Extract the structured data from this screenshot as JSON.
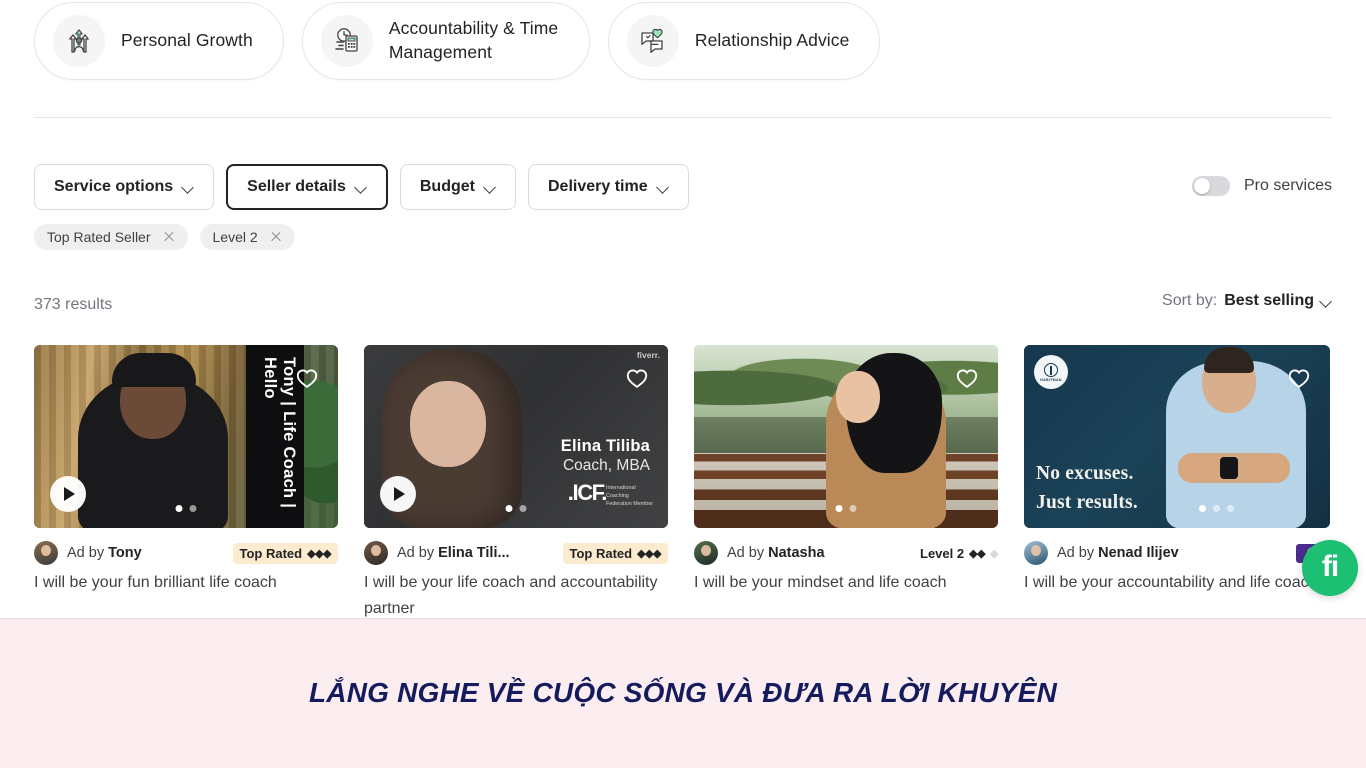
{
  "categories": [
    {
      "label": "Personal Growth",
      "icon": "personal-growth-icon",
      "two_line": false
    },
    {
      "label": "Accountability & Time Management",
      "icon": "clock-calculator-icon",
      "two_line": true
    },
    {
      "label": "Relationship Advice",
      "icon": "chat-heart-icon",
      "two_line": false
    }
  ],
  "filters": {
    "buttons": [
      {
        "label": "Service options",
        "active": false
      },
      {
        "label": "Seller details",
        "active": true
      },
      {
        "label": "Budget",
        "active": false
      },
      {
        "label": "Delivery time",
        "active": false
      }
    ],
    "applied_pills": [
      "Top Rated Seller",
      "Level 2"
    ],
    "pro_services_label": "Pro services",
    "pro_services_on": false
  },
  "results": {
    "count_label": "373 results",
    "sort_label": "Sort by:",
    "sort_value": "Best selling"
  },
  "cards": [
    {
      "overlay_text": "Tony | Life Coach | Hello",
      "seller": "Tony",
      "ad_by_prefix": "Ad by",
      "badge_label": "Top Rated",
      "badge_type": "top-rated",
      "diamonds_filled": 3,
      "diamonds_total": 3,
      "title": "I will be your fun brilliant life coach",
      "has_play": true,
      "dots": 2,
      "active_dot": 0
    },
    {
      "overlay_name": "Elina Tiliba",
      "overlay_subtitle": "Coach, MBA",
      "logo_text": ".ICF.",
      "logo_sub": "International Coaching Federation Member",
      "watermark": "fiverr.",
      "seller": "Elina Tili...",
      "ad_by_prefix": "Ad by",
      "badge_label": "Top Rated",
      "badge_type": "top-rated",
      "diamonds_filled": 3,
      "diamonds_total": 3,
      "title": "I will be your life coach and accountability partner",
      "has_play": true,
      "dots": 2,
      "active_dot": 0
    },
    {
      "seller": "Natasha",
      "ad_by_prefix": "Ad by",
      "badge_label": "Level 2",
      "badge_type": "level",
      "diamonds_filled": 2,
      "diamonds_total": 3,
      "title": "I will be your mindset and life coach",
      "has_play": false,
      "dots": 2,
      "active_dot": 0
    },
    {
      "headline_line1": "No excuses.",
      "headline_line2": "Just results.",
      "logo_text": "HABITMAN",
      "seller": "Nenad Ilijev",
      "ad_by_prefix": "Ad by",
      "badge_label": "",
      "badge_type": "pro",
      "diamonds_filled": 0,
      "diamonds_total": 0,
      "title": "I will be your accountability and life coach",
      "has_play": false,
      "dots": 3,
      "active_dot": 0
    }
  ],
  "banner": {
    "text": "LẮNG NGHE VỀ CUỘC SỐNG VÀ ĐƯA RA LỜI KHUYÊN"
  },
  "floating_button": {
    "glyph": "fi",
    "name": "fiverr-chat-button"
  },
  "colors": {
    "brand_green": "#1dbf73",
    "badge_bg": "#fdebd0",
    "pro_purple": "#4c2d8f",
    "banner_bg": "#fcedf0",
    "banner_text": "#141c5e"
  }
}
